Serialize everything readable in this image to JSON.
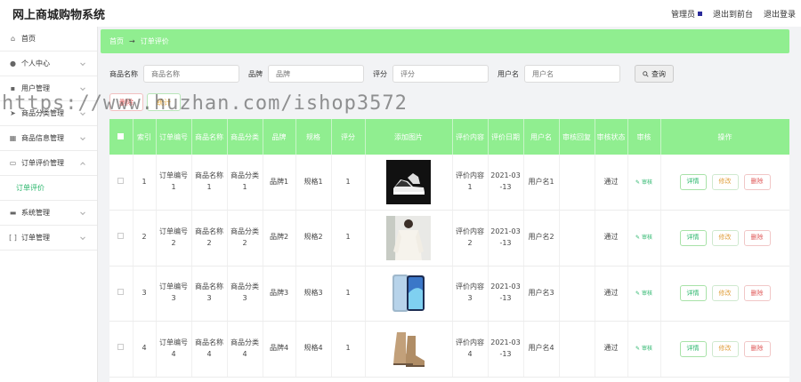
{
  "header": {
    "title": "网上商城购物系统",
    "admin_label": "管理员",
    "links": [
      "退出到前台",
      "退出登录"
    ]
  },
  "sidebar": {
    "items": [
      {
        "label": "首页",
        "icon": "home-icon",
        "has_chevron": false
      },
      {
        "label": "个人中心",
        "icon": "user-icon",
        "has_chevron": true
      },
      {
        "label": "用户管理",
        "icon": "users-icon",
        "has_chevron": true
      },
      {
        "label": "商品分类管理",
        "icon": "send-icon",
        "has_chevron": true
      },
      {
        "label": "商品信息管理",
        "icon": "grid-icon",
        "has_chevron": true
      },
      {
        "label": "订单评价管理",
        "icon": "chat-icon",
        "has_chevron": true,
        "expanded": true
      },
      {
        "label": "订单评价",
        "sub": true
      },
      {
        "label": "系统管理",
        "icon": "monitor-icon",
        "has_chevron": true
      },
      {
        "label": "订单管理",
        "icon": "bracket-icon",
        "has_chevron": true
      }
    ]
  },
  "breadcrumb": {
    "home": "首页",
    "separator": "→",
    "current": "订单评价"
  },
  "search": {
    "fields": [
      {
        "label": "商品名称",
        "placeholder": "商品名称"
      },
      {
        "label": "品牌",
        "placeholder": "品牌"
      },
      {
        "label": "评分",
        "placeholder": "评分"
      },
      {
        "label": "用户名",
        "placeholder": "用户名"
      }
    ],
    "query_label": "查询"
  },
  "actions": {
    "delete_label": "删除",
    "stats_label": "统计"
  },
  "table": {
    "columns": [
      "索引",
      "订单编号",
      "商品名称",
      "商品分类",
      "品牌",
      "规格",
      "评分",
      "添加图片",
      "评价内容",
      "评价日期",
      "用户名",
      "审核回复",
      "审核状态",
      "审核",
      "操作"
    ],
    "rows": [
      {
        "index": "1",
        "order_no": "订单编号\n1",
        "name": "商品名称\n1",
        "category": "商品分类\n1",
        "brand": "品牌1",
        "spec": "规格1",
        "score": "1",
        "image": "sneaker",
        "content": "评价内容\n1",
        "date": "2021-03\n-13",
        "user": "用户名1",
        "reply": "",
        "status": "通过"
      },
      {
        "index": "2",
        "order_no": "订单编号\n2",
        "name": "商品名称\n2",
        "category": "商品分类\n2",
        "brand": "品牌2",
        "spec": "规格2",
        "score": "1",
        "image": "blouse",
        "content": "评价内容\n2",
        "date": "2021-03\n-13",
        "user": "用户名2",
        "reply": "",
        "status": "通过"
      },
      {
        "index": "3",
        "order_no": "订单编号\n3",
        "name": "商品名称\n3",
        "category": "商品分类\n3",
        "brand": "品牌3",
        "spec": "规格3",
        "score": "1",
        "image": "phone",
        "content": "评价内容\n3",
        "date": "2021-03\n-13",
        "user": "用户名3",
        "reply": "",
        "status": "通过"
      },
      {
        "index": "4",
        "order_no": "订单编号\n4",
        "name": "商品名称\n4",
        "category": "商品分类\n4",
        "brand": "品牌4",
        "spec": "规格4",
        "score": "1",
        "image": "boots",
        "content": "评价内容\n4",
        "date": "2021-03\n-13",
        "user": "用户名4",
        "reply": "",
        "status": "通过"
      }
    ],
    "review_label": "审核",
    "ops": {
      "detail": "详情",
      "edit": "修改",
      "delete": "删除"
    }
  },
  "watermark": "https://www.huzhan.com/ishop3572",
  "colors": {
    "accent": "#90ee90",
    "link_green": "#29b66b",
    "danger": "#e05a5a",
    "warning": "#e0a040"
  }
}
